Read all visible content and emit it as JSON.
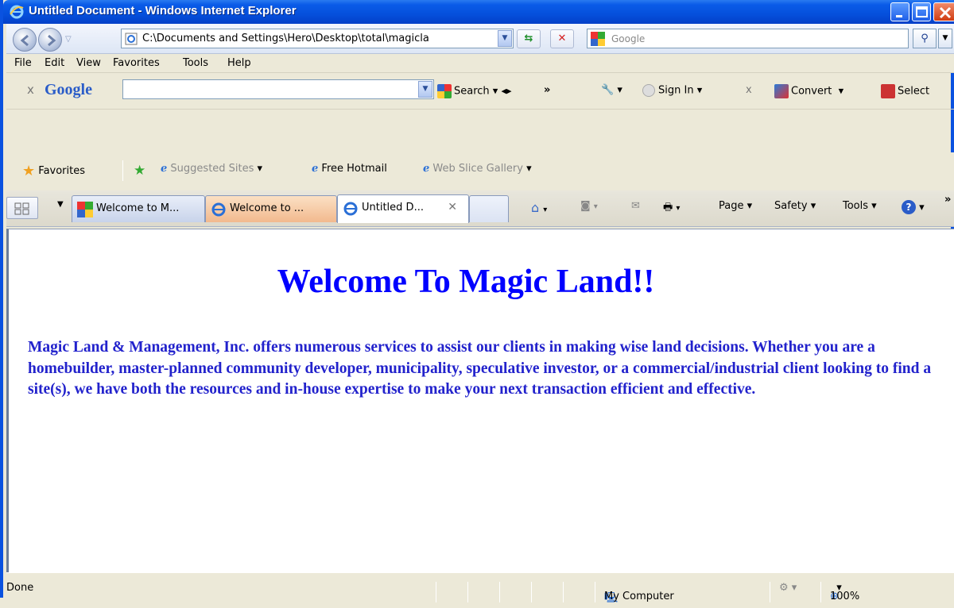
{
  "window": {
    "title": "Untitled Document - Windows Internet Explorer"
  },
  "address": {
    "url": "C:\\Documents and Settings\\Hero\\Desktop\\total\\magicla"
  },
  "search": {
    "placeholder": "Google"
  },
  "menu": [
    "File",
    "Edit",
    "View",
    "Favorites",
    "Tools",
    "Help"
  ],
  "google_toolbar": {
    "close": "x",
    "logo": "Google",
    "search_label": "Search",
    "more": "»",
    "sign_in": "Sign In",
    "close2": "x",
    "convert": "Convert",
    "select": "Select"
  },
  "favorites_bar": {
    "favorites": "Favorites",
    "suggested": "Suggested Sites",
    "hotmail": "Free Hotmail",
    "webslice": "Web Slice Gallery"
  },
  "tabs": [
    "Welcome to M...",
    "Welcome to ...",
    "Untitled D..."
  ],
  "command_bar": {
    "page": "Page",
    "safety": "Safety",
    "tools": "Tools",
    "more": "»"
  },
  "page": {
    "heading": "Welcome To Magic Land!!",
    "body": "Magic Land & Management, Inc. offers numerous services to assist our clients in making wise land decisions. Whether you are a homebuilder, master-planned community developer, municipality, speculative investor, or a commercial/industrial client looking to find a site(s), we have both the resources and in-house expertise to make your next transaction efficient and effective."
  },
  "status_bar": {
    "status": "Done",
    "zone": "My Computer",
    "zoom": "100%"
  }
}
